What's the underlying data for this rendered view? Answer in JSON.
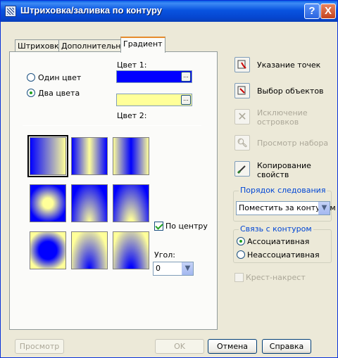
{
  "window": {
    "title": "Штриховка/заливка по контуру",
    "help_label": "?",
    "close_label": "X"
  },
  "tabs": [
    {
      "label": "Штриховка"
    },
    {
      "label": "Дополнительные"
    },
    {
      "label": "Градиент",
      "active": true
    }
  ],
  "gradient_tab": {
    "color1_label": "Цвет 1:",
    "color2_label": "Цвет 2:",
    "one_color_label": "Один цвет",
    "two_colors_label": "Два цвета",
    "selected_mode": "two_colors",
    "color1_value": "#0000ff",
    "color2_value": "#ffff99",
    "swatch_button_label": "...",
    "centered_label": "По центру",
    "centered_checked": true,
    "angle_label": "Угол:",
    "angle_value": "0",
    "selected_pattern": 0
  },
  "side": {
    "pick_points_label": "Указание точек",
    "select_objects_label": "Выбор объектов",
    "remove_islands_label": "Исключение островков",
    "view_selection_label": "Просмотр набора",
    "inherit_properties_label": "Копирование свойств",
    "draw_order": {
      "title": "Порядок следования",
      "value": "Поместить за контуром"
    },
    "associativity": {
      "title": "Связь с контуром",
      "associative_label": "Ассоциативная",
      "nonassociative_label": "Неассоциативная",
      "selected": "associative"
    },
    "cross_hatch_label": "Крест-накрест",
    "cross_hatch_checked": false
  },
  "footer": {
    "preview_label": "Просмотр",
    "ok_label": "OK",
    "cancel_label": "Отмена",
    "help_label": "Справка"
  },
  "colors": {
    "title_bar": "#0a54e0",
    "dialog_bg": "#ece9d8",
    "group_title": "#0046d5",
    "active_tab_accent": "#e68b2c"
  }
}
